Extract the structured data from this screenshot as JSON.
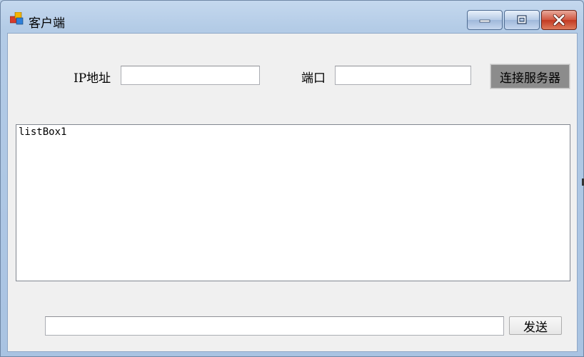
{
  "window": {
    "title": "客户端",
    "icons": {
      "app": "windows-app-icon",
      "minimize": "minimize-icon",
      "maximize": "maximize-icon",
      "close": "close-icon"
    }
  },
  "form": {
    "ip_label": "IP地址",
    "ip_value": "",
    "port_label": "端口",
    "port_value": "",
    "connect_label": "连接服务器",
    "list_items": [
      "listBox1"
    ],
    "message_value": "",
    "send_label": "发送"
  },
  "colors": {
    "connect_button_bg": "#8c8c8c",
    "close_button": "#c23a22",
    "client_bg": "#f0f0f0"
  }
}
